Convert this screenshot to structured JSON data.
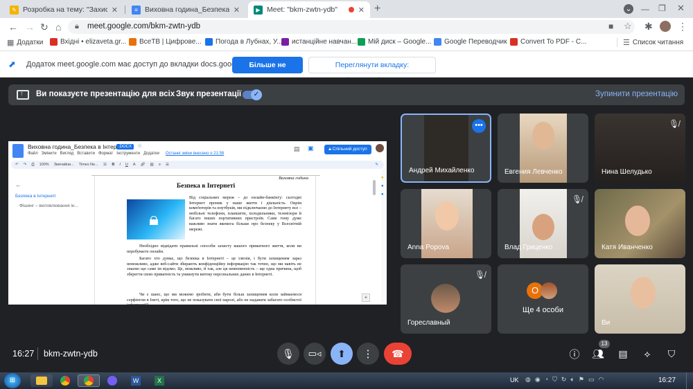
{
  "browser": {
    "tabs": [
      {
        "title": "Розробка на тему: \"Захист інфор",
        "color": "#f4b400"
      },
      {
        "title": "Виховна година_Безпека в Інт",
        "color": "#4285f4"
      },
      {
        "title": "Meet: \"bkm-zwtn-ydb\"",
        "color": "#00897b"
      }
    ],
    "url": "meet.google.com/bkm-zwtn-ydb",
    "bookmarks": [
      {
        "label": "Додатки",
        "color": "#5f6368"
      },
      {
        "label": "Вхідні • elizaveta.gr...",
        "color": "#d93025"
      },
      {
        "label": "ВсеТВ | Цифрове...",
        "color": "#e8710a"
      },
      {
        "label": "Погода в Лубнах, У...",
        "color": "#1a73e8"
      },
      {
        "label": "истанційне навчан...",
        "color": "#7b1fa2"
      },
      {
        "label": "Мій диск – Google...",
        "color": "#0f9d58"
      },
      {
        "label": "Google Переводчик",
        "color": "#4285f4"
      },
      {
        "label": "Convert To PDF - C...",
        "color": "#d93025"
      }
    ],
    "reading_list": "Список читання"
  },
  "sharebar": {
    "text": "Додаток meet.google.com має доступ до вкладки docs.google.com",
    "stop_sharing": "Більше не ділитися",
    "view_tab": "Переглянути вкладку: docs.google.com"
  },
  "presbar": {
    "text": "Ви показуєте презентацію для всіх",
    "sound_label": "Звук презентації",
    "stop_label": "Зупинити презентацію"
  },
  "doc": {
    "title": "Виховна година_Безпека в Інтернеті",
    "ext": ".DOCX",
    "menu": [
      "Файл",
      "Змінити",
      "Вигляд",
      "Вставити",
      "Формат",
      "Інструменти",
      "Додатки"
    ],
    "last_edit": "Останні зміни внесено о 21:58",
    "share_label": "Спільний доступ",
    "toolbar_font": "Times Ne...",
    "toolbar_size": "11",
    "toolbar_zoom": "100%",
    "toolbar_style": "Звичайни...",
    "outline": [
      "Безпека в Інтернеті",
      "Фішинг – виловлювання ін..."
    ],
    "page_header": "Виховна година",
    "heading": "Безпека в Інтернеті",
    "para1": "Від соціальних мереж – до онлайн-банкінгу: сьогодні Інтернет проник у наше життя і діяльність. Окрім комп'ютерів та ноутбуків, ми підключаємо до Інтернету все – мобільні телефони, планшети, холодильники, телевізори й багато інших портативних пристроїв. Саме тому дуже важливо знати якомога більше про безпеку у Всесвітній мережі.",
    "para2": "Необхідно відвідати правильні способи захисту вашого приватного життя, коли ви перебуваєте онлайн.",
    "para3": "Багато хто думає, що безпека в Інтернеті – це ілюзія, і бути захищеним зараз неможливо, адже веб-сайти збирають конфіденційну інформацію так точно, що ми навіть не знаємо що саме ім відомо. Це, можливо, й так, але ця невпевненість – ще одна причина, щоб зберегти свою приватність та уникнути витоку персональних даних в Інтернеті.",
    "para4": "Чи є шанс, що ми можемо зробити, аби бути більш захищеним коли займаємося серфінгом в Інеті, крім того, що не показувати свої паролі, або не надавати забагато особистої інформації?"
  },
  "participants": [
    {
      "name": "Андрей Михайленко",
      "muted": false,
      "active": true,
      "bg": "#2e2a26"
    },
    {
      "name": "Евгения Левченко",
      "muted": false,
      "active": false,
      "bg": "#b89a7a"
    },
    {
      "name": "Нина Шелудько",
      "muted": true,
      "active": false,
      "bg": "#2a2624"
    },
    {
      "name": "Anna Popova",
      "muted": false,
      "active": false,
      "bg": "#c9a58a"
    },
    {
      "name": "Влад Гриценко",
      "muted": true,
      "active": false,
      "bg": "#d8d4cc"
    },
    {
      "name": "Катя Иванченко",
      "muted": false,
      "active": false,
      "bg": "#8a7a5a"
    },
    {
      "name": "Гореславный",
      "muted": true,
      "active": false,
      "bg": "#3c4043"
    },
    {
      "name": "Ще 4 особи",
      "muted": false,
      "active": false,
      "bg": "#3c4043"
    },
    {
      "name": "Ви",
      "muted": false,
      "active": false,
      "bg": "#c7bda8"
    }
  ],
  "more_avatar_letter": "O",
  "controls": {
    "time": "16:27",
    "meeting_code": "bkm-zwtn-ydb",
    "participants_count": "13"
  },
  "taskbar": {
    "lang": "UK",
    "clock": "16:27"
  },
  "colors": {
    "accent": "#8ab4f8",
    "end_call": "#ea4335",
    "active_tile": "#8ab4f8",
    "present_btn": "#8ab4f8"
  }
}
